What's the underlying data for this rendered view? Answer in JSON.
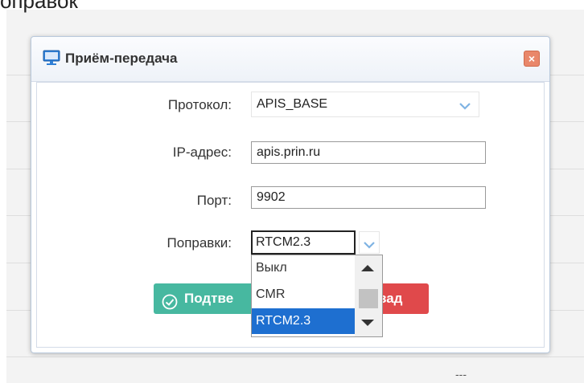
{
  "page": {
    "title_fragment": "оправок",
    "footer_dash": "---"
  },
  "dialog": {
    "title": "Приём-передача",
    "close_icon": "close-icon",
    "monitor_icon": "monitor-icon"
  },
  "form": {
    "protocol": {
      "label": "Протокол:",
      "value": "APIS_BASE"
    },
    "ip": {
      "label": "IP-адрес:",
      "value": "apis.prin.ru"
    },
    "port": {
      "label": "Порт:",
      "value": "9902"
    },
    "corrections": {
      "label": "Поправки:",
      "value": "RTCM2.3",
      "options": [
        "Выкл",
        "CMR",
        "RTCM2.3"
      ],
      "selected_index": 2
    }
  },
  "buttons": {
    "confirm": "Подтве",
    "back": "зад"
  },
  "colors": {
    "confirm": "#47b8a0",
    "back": "#e0494b",
    "selected_option": "#1e6fd0",
    "close": "#e9876a"
  }
}
